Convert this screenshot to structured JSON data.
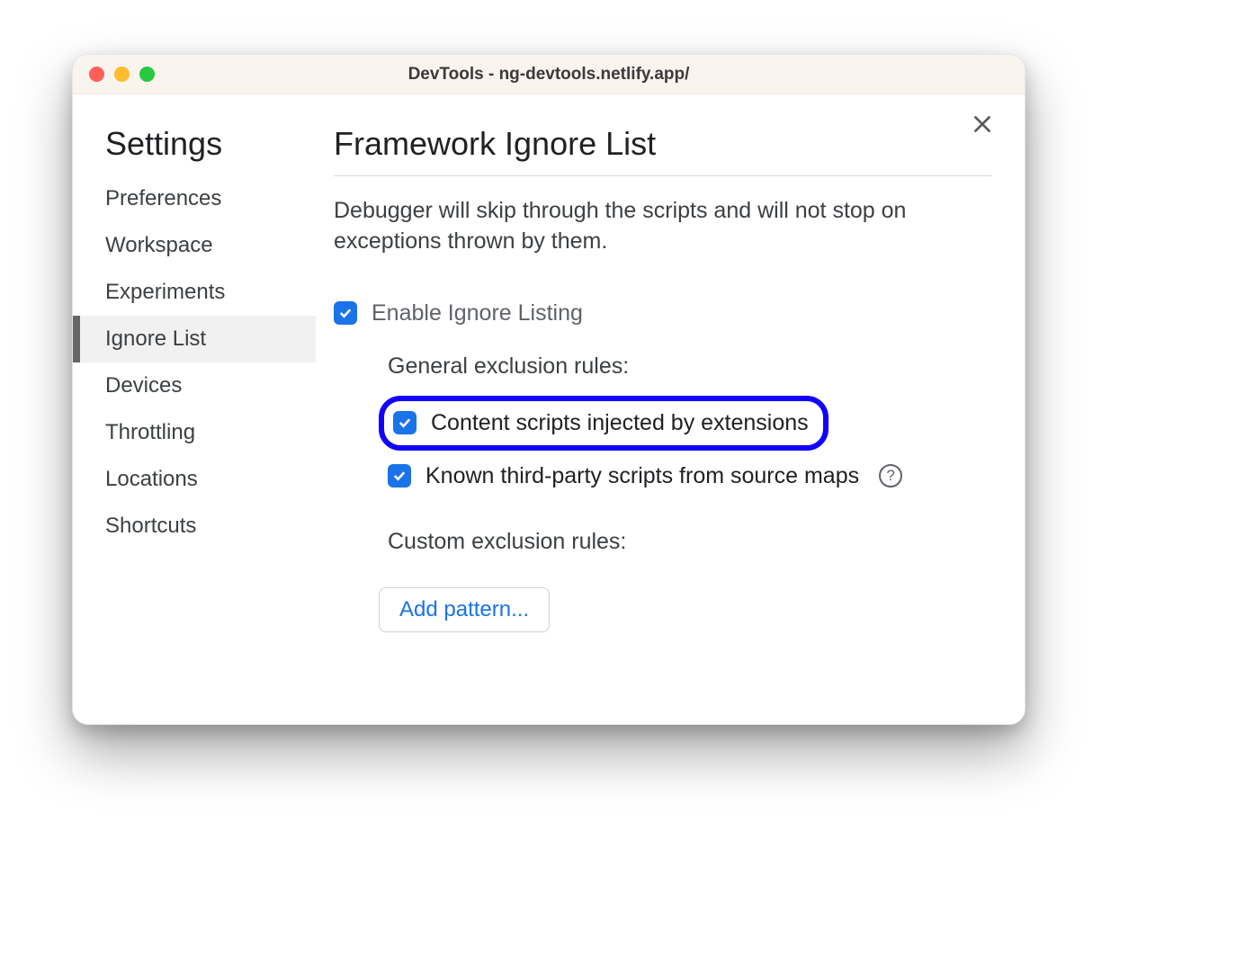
{
  "window": {
    "title": "DevTools - ng-devtools.netlify.app/"
  },
  "sidebar": {
    "title": "Settings",
    "items": [
      {
        "label": "Preferences",
        "active": false
      },
      {
        "label": "Workspace",
        "active": false
      },
      {
        "label": "Experiments",
        "active": false
      },
      {
        "label": "Ignore List",
        "active": true
      },
      {
        "label": "Devices",
        "active": false
      },
      {
        "label": "Throttling",
        "active": false
      },
      {
        "label": "Locations",
        "active": false
      },
      {
        "label": "Shortcuts",
        "active": false
      }
    ]
  },
  "main": {
    "title": "Framework Ignore List",
    "description": "Debugger will skip through the scripts and will not stop on exceptions thrown by them.",
    "enable_label": "Enable Ignore Listing",
    "enable_checked": true,
    "general_rules_heading": "General exclusion rules:",
    "rule_content_scripts": {
      "label": "Content scripts injected by extensions",
      "checked": true,
      "highlighted": true
    },
    "rule_third_party": {
      "label": "Known third-party scripts from source maps",
      "checked": true,
      "has_help": true
    },
    "custom_rules_heading": "Custom exclusion rules:",
    "add_pattern_label": "Add pattern..."
  },
  "colors": {
    "accent": "#1a73e8",
    "highlight_border": "#1200ff"
  }
}
